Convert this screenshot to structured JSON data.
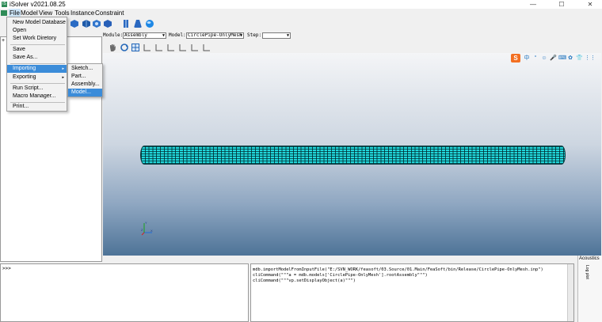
{
  "window": {
    "title": "iSolver v2021.08.25",
    "icon_text": "iS",
    "minimize_glyph": "—",
    "maximize_glyph": "☐",
    "close_glyph": "✕"
  },
  "menubar": {
    "items": [
      "File",
      "Model",
      "View",
      "Tools",
      "Instance",
      "Constraint"
    ]
  },
  "file_menu": {
    "items": [
      "New Model Database",
      "Open",
      "Set Work Diretory",
      "Save",
      "Save As...",
      "Importing",
      "Exporting",
      "Run Script...",
      "Macro Manager...",
      "Print..."
    ],
    "submenu_arrow": "▸"
  },
  "import_submenu": {
    "items": [
      "Sketch...",
      "Part...",
      "Assembly...",
      "Model..."
    ]
  },
  "toolbar2": {
    "module_label": "Module:",
    "module_value": "Assembly",
    "model_label": "Model:",
    "model_value": "CirclePipe-OnlyMesh",
    "step_label": "Step:",
    "step_value": "",
    "arrow": "▼"
  },
  "ime": {
    "logo": "S",
    "glyphs": [
      "中",
      "°",
      "☺",
      "🎤",
      "⌨",
      "✿",
      "👕",
      "⋮⋮"
    ]
  },
  "left_panel": {
    "tab_glyph": "+"
  },
  "triad": {
    "y": "Y",
    "x": "X",
    "z": "Z"
  },
  "command": {
    "prompt": ">>>"
  },
  "messages": {
    "lines": [
      "mdb.importModelFromInputFile(\"E:/SVN_WORK/feasoft/03.Source/01.Main/FeaSoft/bin/Release/CirclePipe-OnlyMesh.inp\")",
      "cliCommand(\"\"\"a = mdb.models['CirclePipe-OnlyMesh'].rootAssembly\"\"\")",
      "cliCommand(\"\"\"vp.setDisplayObject(a)\"\"\")"
    ]
  },
  "right_strip": {
    "title": "Acoustics",
    "tab_label": "Log plot"
  },
  "colors": {
    "pipe": "#21d8dc",
    "menu_highlight": "#3b8cd9",
    "menu_file_active": "#cce4f7",
    "ime_logo": "#f36f21"
  }
}
